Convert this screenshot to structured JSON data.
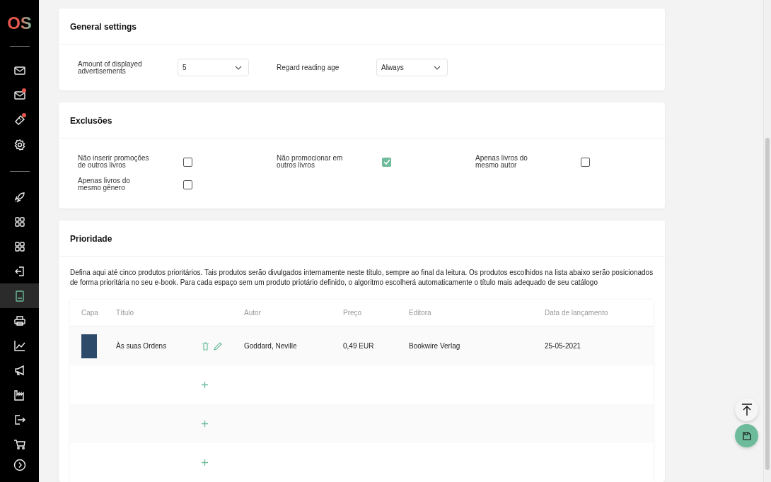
{
  "sidebar": {
    "logo": "OS",
    "groups": [
      [
        {
          "selected": false,
          "badge": false
        },
        {
          "selected": false,
          "badge": true
        },
        {
          "selected": false,
          "badge": true
        },
        {
          "selected": false,
          "badge": false
        }
      ],
      [
        {
          "selected": false,
          "badge": false
        },
        {
          "selected": false,
          "badge": false
        },
        {
          "selected": false,
          "badge": false
        },
        {
          "selected": false,
          "badge": false
        },
        {
          "selected": true,
          "badge": false
        },
        {
          "selected": false,
          "badge": false
        },
        {
          "selected": false,
          "badge": false
        },
        {
          "selected": false,
          "badge": false
        },
        {
          "selected": false,
          "badge": false
        },
        {
          "selected": false,
          "badge": false
        },
        {
          "selected": false,
          "badge": false
        }
      ]
    ]
  },
  "general_settings": {
    "title": "General settings",
    "fields": [
      {
        "label": "Amount of displayed advertisements",
        "value": "5"
      },
      {
        "label": "Regard reading age",
        "value": "Always"
      }
    ]
  },
  "exclusions": {
    "title": "Exclusões",
    "options": [
      {
        "label": "Não inserir promoções de outros livros",
        "checked": false
      },
      {
        "label": "Não promocionar em outros livros",
        "checked": true
      },
      {
        "label": "Apenas livros do mesmo autor",
        "checked": false
      },
      {
        "label": "Apenas livros do mesmo gênero",
        "checked": false
      }
    ]
  },
  "priority": {
    "title": "Prioridade",
    "description": "Defina aqui até cinco produtos prioritários. Tais produtos serão divulgados internamente neste título, sempre ao final da leitura. Os produtos escolhidos na lista abaixo serão posicionados de forma prioritária no seu e-book. Para cada espaço sem um produto priotário definido, o algoritmo escolherá automaticamente o título mais adequado de seu catálogo",
    "table": {
      "columns": [
        "Capa",
        "Título",
        "Autor",
        "Preço",
        "Editora",
        "Data de lançamento"
      ],
      "rows": [
        {
          "kind": "product",
          "title": "Às suas Ordens",
          "author": "Goddard, Neville",
          "price": "0,49 EUR",
          "publisher": "Bookwire Verlag",
          "date": "25-05-2021"
        },
        {
          "kind": "empty"
        },
        {
          "kind": "empty"
        },
        {
          "kind": "empty"
        }
      ]
    }
  }
}
